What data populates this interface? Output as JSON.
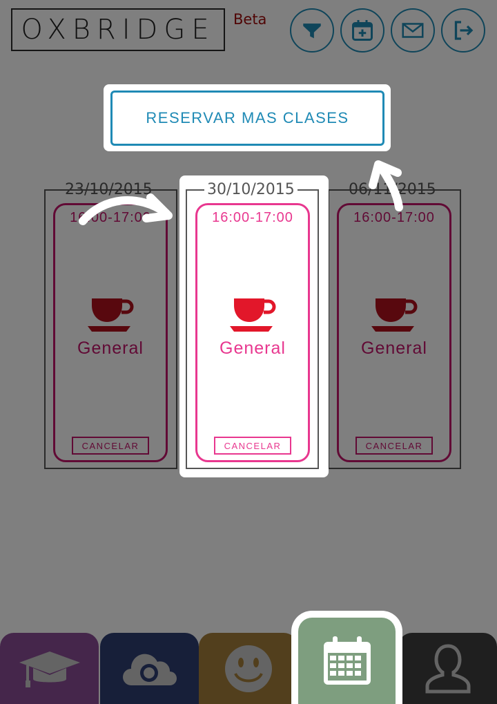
{
  "header": {
    "logo_text": "OXBRIDGE",
    "beta_label": "Beta",
    "icons": [
      "filter-icon",
      "calendar-add-icon",
      "mail-icon",
      "logout-icon"
    ]
  },
  "reserve_button": {
    "label": "RESERVAR MAS CLASES"
  },
  "classes": [
    {
      "date": "23/10/2015",
      "time": "16:00-17:00",
      "category": "General",
      "cancel_label": "CANCELAR"
    },
    {
      "date": "30/10/2015",
      "time": "16:00-17:00",
      "category": "General",
      "cancel_label": "CANCELAR"
    },
    {
      "date": "06/11/2015",
      "time": "16:00-17:00",
      "category": "General",
      "cancel_label": "CANCELAR"
    }
  ],
  "tabs": [
    {
      "icon": "graduation-cap-icon",
      "color": "#8b4d96"
    },
    {
      "icon": "cloud-camera-icon",
      "color": "#2f3f73"
    },
    {
      "icon": "smiley-icon",
      "color": "#a57f3a"
    },
    {
      "icon": "calendar-icon",
      "color": "#7e9e7f"
    },
    {
      "icon": "user-icon",
      "color": "#3f3f3f"
    }
  ],
  "colors": {
    "accent_blue": "#1f8ab5",
    "accent_magenta": "#c3146a",
    "cup_red": "#b0101d"
  }
}
